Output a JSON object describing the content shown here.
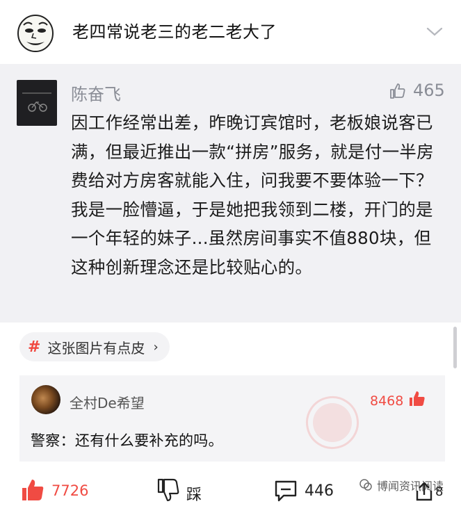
{
  "post": {
    "title": "老四常说老三的老二老大了"
  },
  "quote": {
    "author": "陈奋飞",
    "likes": "465",
    "body": "因工作经常出差，昨晚订宾馆时，老板娘说客已满，但最近推出一款“拼房”服务，就是付一半房费给对方房客就能入住，问我要不要体验一下？我是一脸懵逼，于是她把我领到二楼，开门的是一个年轻的妹子...虽然房间事实不值880块，但这种创新理念还是比较贴心的。"
  },
  "topic": {
    "hash": "#",
    "label": "这张图片有点皮",
    "arrow": "›"
  },
  "reply": {
    "user": "全村De希望",
    "likes": "8468",
    "text": "警察：还有什么要补充的吗。"
  },
  "footer": {
    "likes": "7726",
    "dislike_label": "踩",
    "comments": "446",
    "shares": "8",
    "watermark": "博闻资讯阅读"
  },
  "colors": {
    "accent_red": "#f04b43",
    "card_bg": "#f1f1f4",
    "muted_text": "#8a8d96"
  },
  "icons": [
    "meme-face-icon",
    "chevron-down-icon",
    "thumbs-up-icon",
    "hash-icon",
    "thumbs-down-icon",
    "comment-icon",
    "share-icon"
  ]
}
